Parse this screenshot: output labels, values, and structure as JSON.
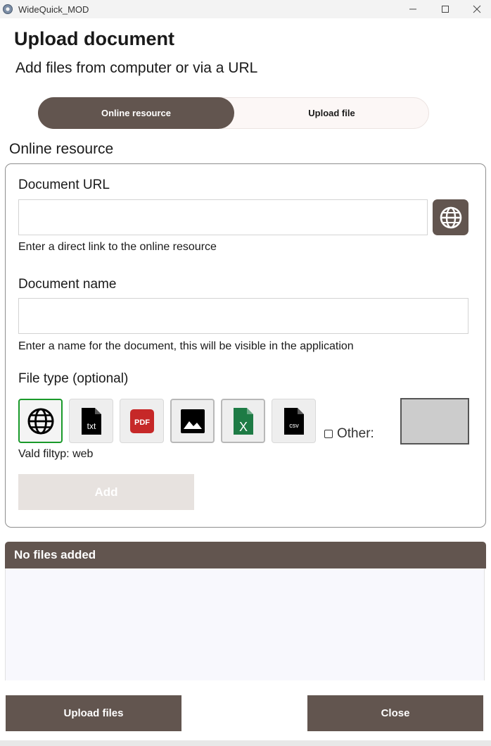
{
  "window": {
    "title": "WideQuick_MOD",
    "minimize_glyph": "—",
    "maximize_glyph": "☐",
    "close_glyph": "✕"
  },
  "header": {
    "title": "Upload document",
    "subtitle": "Add files from computer or via a URL"
  },
  "tabs": {
    "online_label": "Online resource",
    "upload_label": "Upload file",
    "active": "Online resource"
  },
  "section": {
    "heading": "Online resource"
  },
  "form": {
    "url_label": "Document URL",
    "url_value": "",
    "url_hint": "Enter a direct link to the online resource",
    "name_label": "Document name",
    "name_value": "",
    "name_hint": "Enter a name for the document, this will be visible in the application",
    "filetype_label": "File type (optional)",
    "file_types": [
      {
        "name": "web",
        "icon": "globe-icon"
      },
      {
        "name": "txt",
        "icon": "txt-file-icon"
      },
      {
        "name": "pdf",
        "icon": "pdf-file-icon"
      },
      {
        "name": "image",
        "icon": "image-icon"
      },
      {
        "name": "xlsx",
        "icon": "excel-file-icon"
      },
      {
        "name": "csv",
        "icon": "csv-file-icon"
      }
    ],
    "txt_badge": "txt",
    "pdf_badge": "PDF",
    "excel_badge": "X",
    "csv_badge": "csv",
    "other_label": "Other:",
    "other_checked": false,
    "chosen_type_text": "Vald filtyp: web",
    "add_label": "Add"
  },
  "files": {
    "header": "No files added"
  },
  "footer": {
    "upload_label": "Upload files",
    "close_label": "Close"
  },
  "colors": {
    "accent": "#62554f",
    "selected_border": "#1a9a2a",
    "pdf_red": "#c62828",
    "excel_green": "#1e7b45"
  }
}
